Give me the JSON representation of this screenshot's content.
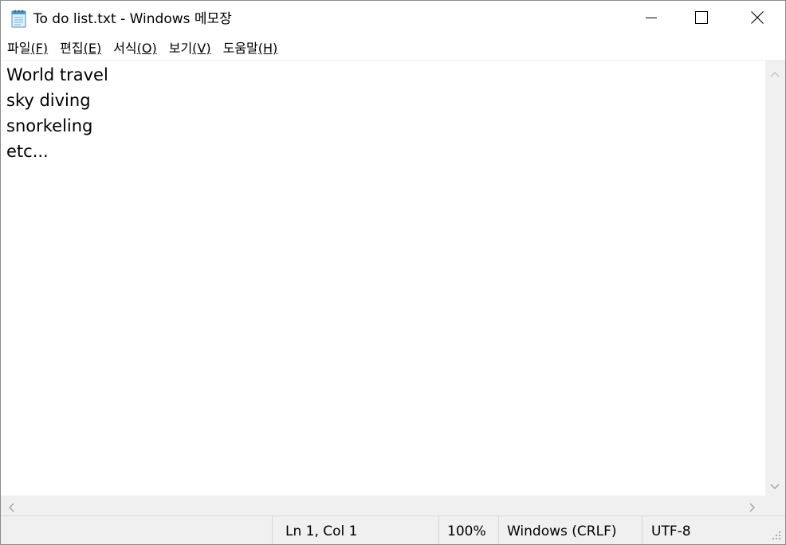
{
  "window": {
    "title": "To do list.txt - Windows 메모장",
    "icon": "notepad-icon"
  },
  "caption_buttons": {
    "minimize": "minimize-icon",
    "maximize": "maximize-icon",
    "close": "close-icon"
  },
  "menu": [
    {
      "label": "파일",
      "accel": "(F)"
    },
    {
      "label": "편집",
      "accel": "(E)"
    },
    {
      "label": "서식",
      "accel": "(O)"
    },
    {
      "label": "보기",
      "accel": "(V)"
    },
    {
      "label": "도움말",
      "accel": "(H)"
    }
  ],
  "document": {
    "lines": [
      "World travel",
      "sky diving",
      "snorkeling",
      "etc..."
    ]
  },
  "status": {
    "position": "Ln 1, Col 1",
    "zoom": "100%",
    "line_ending": "Windows (CRLF)",
    "encoding": "UTF-8"
  }
}
